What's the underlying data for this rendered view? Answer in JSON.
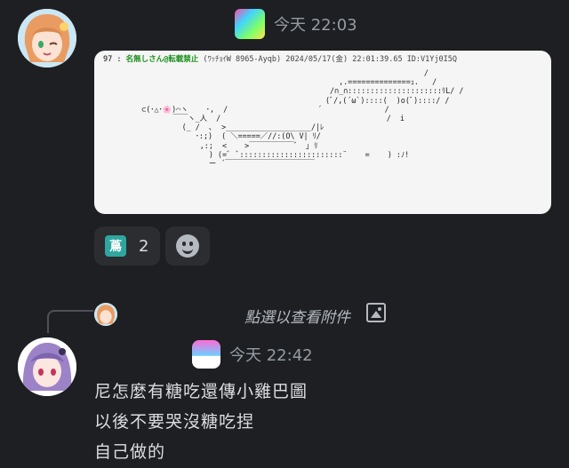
{
  "message1": {
    "timestamp": "今天 22:03",
    "attachment": {
      "post_num": "97",
      "post_name": "名無しさん@転載禁止",
      "post_meta": "(ﾜｯﾁｮｲW 8965-Ayqb)  2024/05/17(金) 22:01:39.65 ID:V1Yj0I5Q",
      "ascii_art": "                                                                    /\n                                                 ,.==============ｭ.   /\n                                               /∩_∩:::::::::::::::::::::ﾘL/ /\n                                              (ﾞ/,(´ω`)::::(  )o(ﾞ)::::/ /\n     ⊂(･△･🌸)⌒ヽ    ･,  /                    ´              /\n            ￣￣ヽ_人  /                                     /  i\n              (_ /  ､  >___________________/|ﾚ\n                 ･:;)  ( ＼=====／//:(O\\ V| ﾘ/\n                  ,:;  <    >￣￣￣￣￣￣゛ ｣ ﾘ\n                    ) (=゛ ﾞ:::::::::::::::::::::::¨    =    ) :ﾉ!\n                    ー ´￣￣￣￣￣￣￣￣￣￣￣￣"
    },
    "reaction": {
      "emoji_label": "蔦",
      "count": "2"
    }
  },
  "message2": {
    "reply_preview_text": "點選以查看附件",
    "timestamp": "今天 22:42",
    "lines": [
      "尼怎麼有糖吃還傳小雞巴圖",
      "以後不要哭沒糖吃捏",
      "自己做的"
    ]
  },
  "icons": {
    "add_reaction": "smile-icon",
    "reply_attachment": "image-icon"
  }
}
